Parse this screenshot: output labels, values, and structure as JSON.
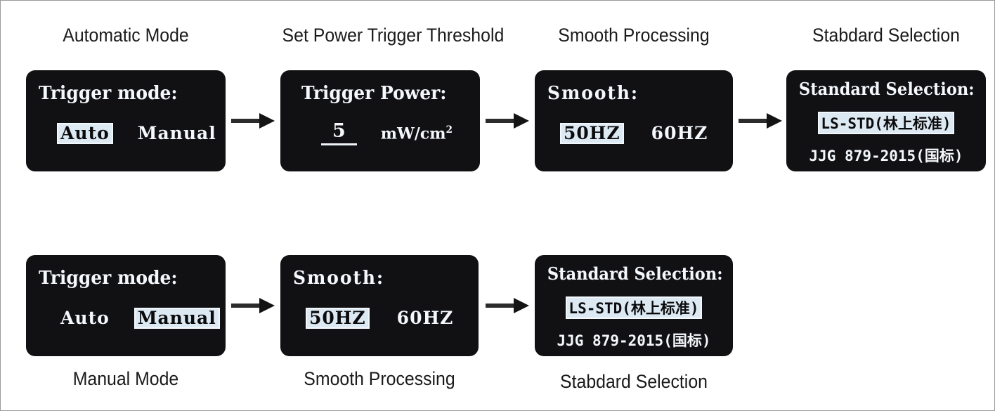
{
  "figure": {
    "background_color": "#ffffff",
    "border_color": "#9a9a9a",
    "lcd_background_color": "#111114",
    "lcd_text_color": "#f4f7fb",
    "highlight_color": "#dde9f2",
    "highlight_text_color": "#0b0b0d",
    "arrow_color": "#2b2b2b"
  },
  "top_row": {
    "captions": [
      "Automatic Mode",
      "Set Power Trigger Threshold",
      "Smooth Processing",
      "Stabdard Selection"
    ],
    "screens": [
      {
        "title": "Trigger mode:",
        "options": [
          {
            "label": "Auto",
            "selected": true
          },
          {
            "label": "Manual",
            "selected": false
          }
        ]
      },
      {
        "title": "Trigger Power:",
        "value": "5",
        "unit_base": "mW/cm",
        "unit_exponent": "2"
      },
      {
        "title": "Smooth:",
        "options": [
          {
            "label": "50HZ",
            "selected": true
          },
          {
            "label": "60HZ",
            "selected": false
          }
        ]
      },
      {
        "title": "Standard Selection:",
        "options": [
          {
            "label": "LS-STD(林上标准)",
            "selected": true
          },
          {
            "label": "JJG 879-2015(国标)",
            "selected": false
          }
        ]
      }
    ],
    "arrow_count": 3
  },
  "bottom_row": {
    "captions": [
      "Manual Mode",
      "Smooth Processing",
      "Stabdard Selection"
    ],
    "screens": [
      {
        "title": "Trigger mode:",
        "options": [
          {
            "label": "Auto",
            "selected": false
          },
          {
            "label": "Manual",
            "selected": true
          }
        ]
      },
      {
        "title": "Smooth:",
        "options": [
          {
            "label": "50HZ",
            "selected": true
          },
          {
            "label": "60HZ",
            "selected": false
          }
        ]
      },
      {
        "title": "Standard Selection:",
        "options": [
          {
            "label": "LS-STD(林上标准)",
            "selected": true
          },
          {
            "label": "JJG 879-2015(国标)",
            "selected": false
          }
        ]
      }
    ],
    "arrow_count": 2
  }
}
